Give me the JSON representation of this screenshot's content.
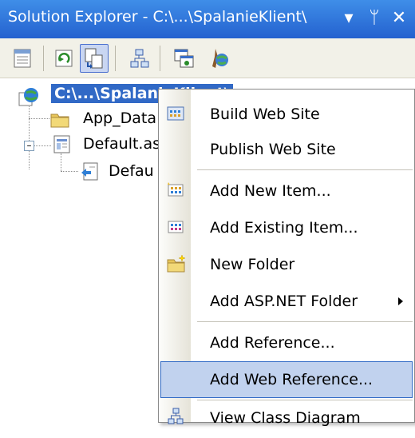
{
  "window": {
    "title": "Solution Explorer - C:\\...\\SpalanieKlient\\",
    "controls": {
      "dropdown": "▾",
      "pin": "ᛘ",
      "close": "✕"
    }
  },
  "toolbar": {
    "buttons": [
      "properties-icon",
      "refresh-icon",
      "nest-related-files-icon",
      "view-class-diagram-icon",
      "copy-web-site-icon",
      "asp-net-configuration-icon"
    ]
  },
  "tree": {
    "root": "C:\\...\\SpalanieKlient\\",
    "items": [
      {
        "label": "App_Data"
      },
      {
        "label": "Default.as"
      },
      {
        "label": "Defau"
      }
    ]
  },
  "context_menu": {
    "items": [
      {
        "label": "Build Web Site",
        "icon": "build-icon"
      },
      {
        "label": "Publish Web Site",
        "icon": ""
      },
      {
        "label": "Add New Item...",
        "icon": "add-new-item-icon"
      },
      {
        "label": "Add Existing Item...",
        "icon": "add-existing-item-icon"
      },
      {
        "label": "New Folder",
        "icon": "new-folder-icon"
      },
      {
        "label": "Add ASP.NET Folder",
        "icon": "",
        "submenu": true
      },
      {
        "label": "Add Reference...",
        "icon": ""
      },
      {
        "label": "Add Web Reference...",
        "icon": "",
        "highlighted": true
      },
      {
        "label": "View Class Diagram",
        "icon": "class-diagram-icon"
      }
    ]
  },
  "colors": {
    "titlebar": "#2f76dc",
    "selection": "#3169c6",
    "menu_highlight": "#c1d2ee"
  }
}
